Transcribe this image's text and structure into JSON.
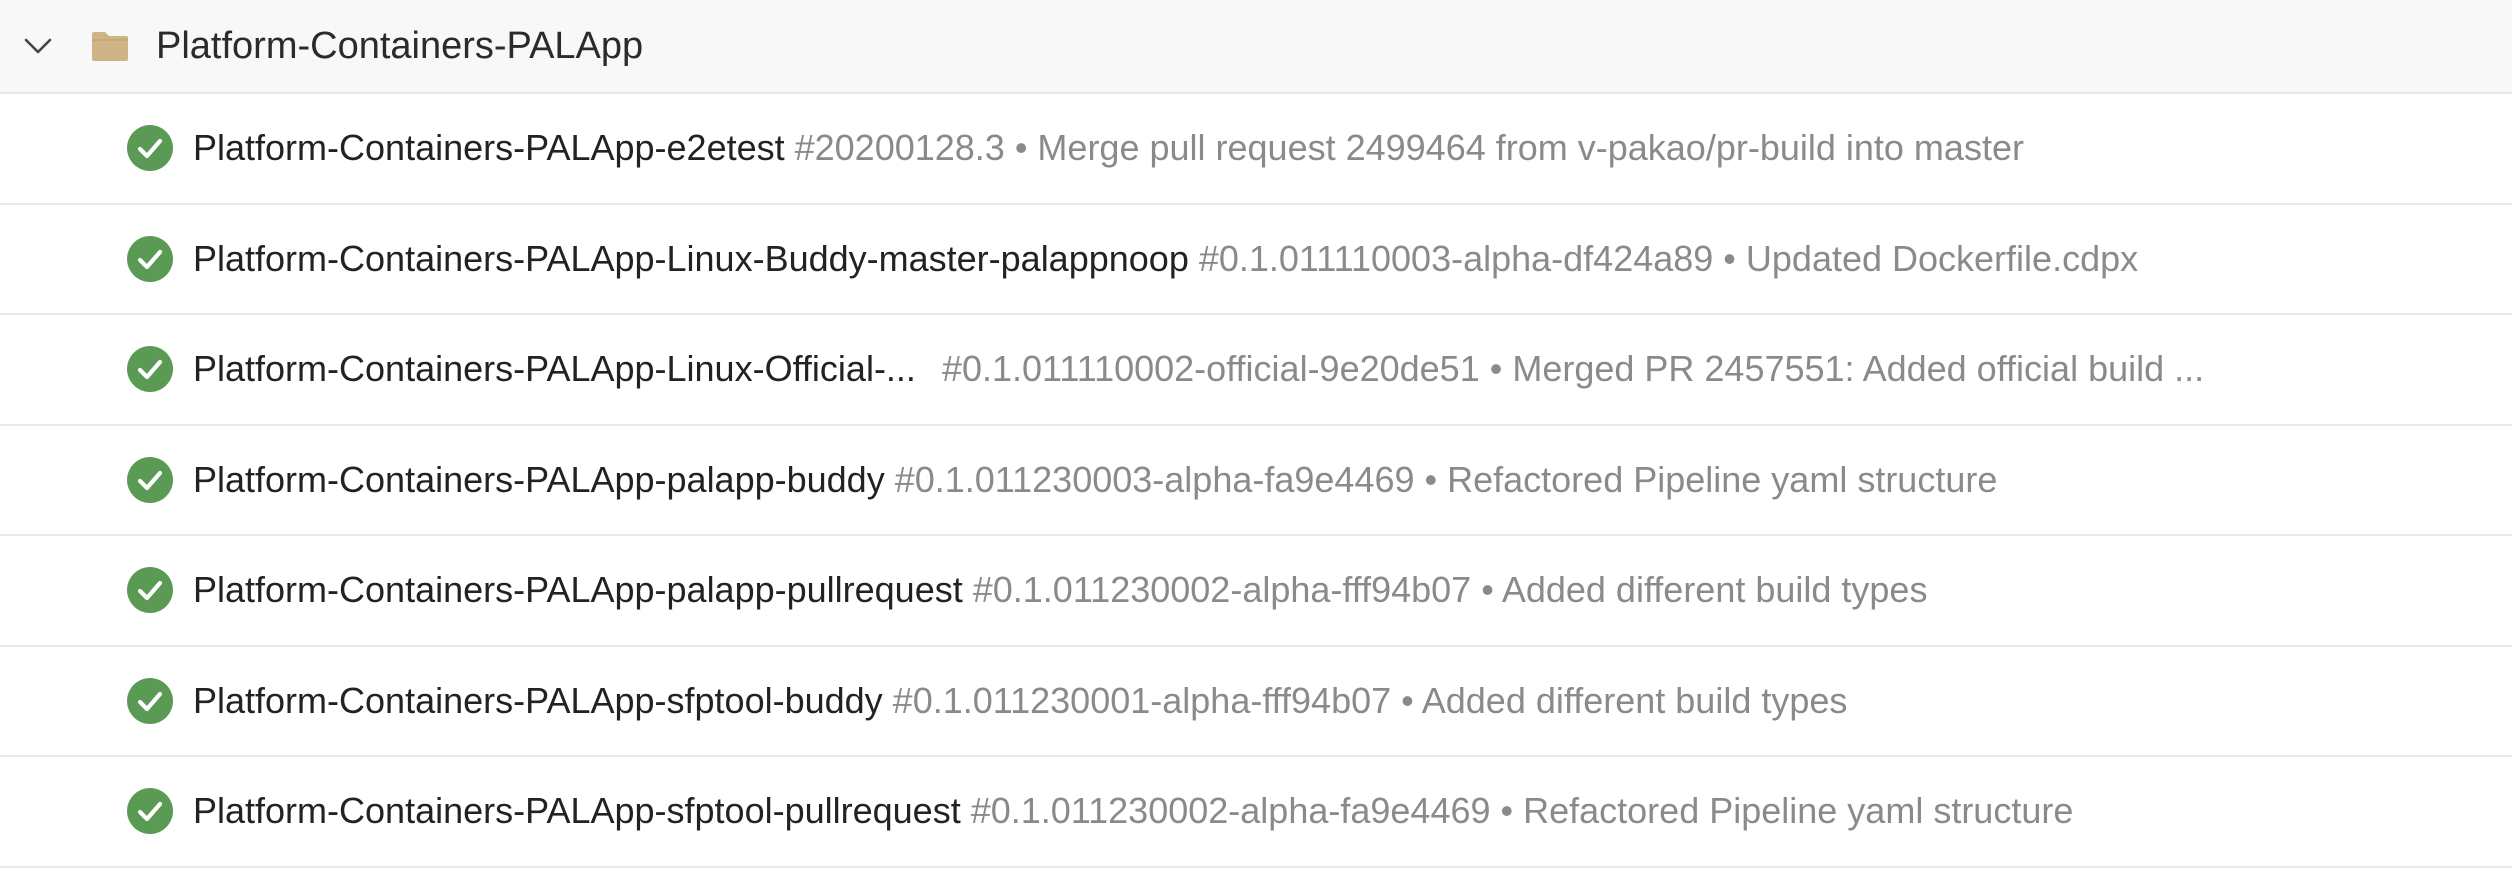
{
  "folder": {
    "name": "Platform-Containers-PALApp",
    "expander_icon": "chevron-down-icon",
    "folder_icon": "folder-icon",
    "folder_color": "#cfb585"
  },
  "status_color": "#5a9a55",
  "pipelines": [
    {
      "name": "Platform-Containers-PALApp-e2etest",
      "run": "#20200128.3 • Merge pull request 2499464 from v-pakao/pr-build into master",
      "status": "succeeded"
    },
    {
      "name": "Platform-Containers-PALApp-Linux-Buddy-master-palappnoop",
      "run": "#0.1.011110003-alpha-df424a89 • Updated Dockerfile.cdpx",
      "status": "succeeded"
    },
    {
      "name": "Platform-Containers-PALApp-Linux-Official-...",
      "run": "#0.1.011110002-official-9e20de51 • Merged PR 2457551: Added official build ...",
      "status": "succeeded"
    },
    {
      "name": "Platform-Containers-PALApp-palapp-buddy",
      "run": "#0.1.011230003-alpha-fa9e4469 • Refactored Pipeline yaml structure",
      "status": "succeeded"
    },
    {
      "name": "Platform-Containers-PALApp-palapp-pullrequest",
      "run": "#0.1.011230002-alpha-fff94b07 • Added different build types",
      "status": "succeeded"
    },
    {
      "name": "Platform-Containers-PALApp-sfptool-buddy",
      "run": "#0.1.011230001-alpha-fff94b07 • Added different build types",
      "status": "succeeded"
    },
    {
      "name": "Platform-Containers-PALApp-sfptool-pullrequest",
      "run": "#0.1.011230002-alpha-fa9e4469 • Refactored Pipeline yaml structure",
      "status": "succeeded"
    }
  ]
}
